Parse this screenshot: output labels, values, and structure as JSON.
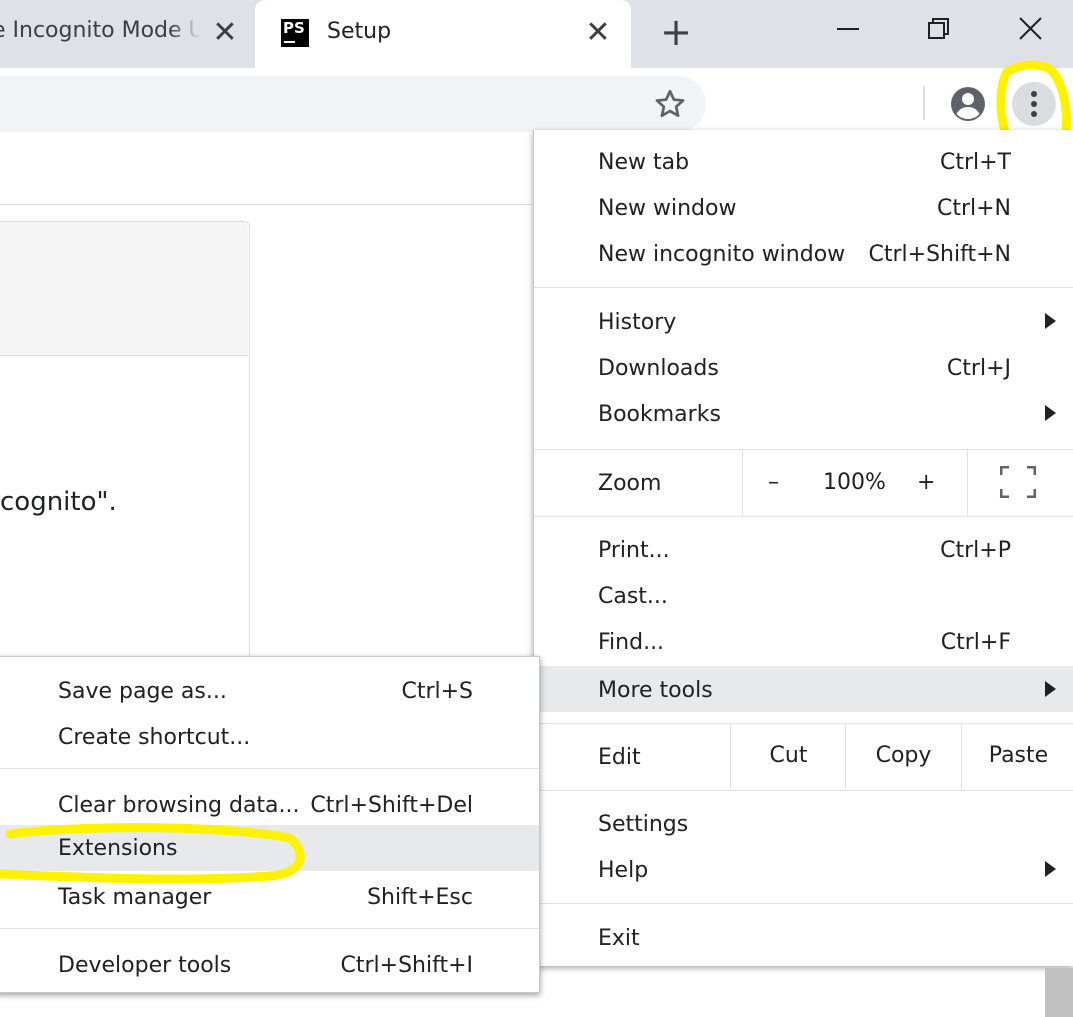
{
  "browser": {
    "tabs": [
      {
        "title": "e Incognito Mode U",
        "active": false
      },
      {
        "title": "Setup",
        "active": true,
        "favicon_text": "PS"
      }
    ],
    "close_glyph": "✕",
    "new_tab_glyph": "+",
    "window_controls": [
      "minimize-icon",
      "restore-icon",
      "close-icon"
    ]
  },
  "toolbar": {
    "icons": [
      "star-icon",
      "profile-icon",
      "more-vert-icon"
    ]
  },
  "page": {
    "visible_text": "cognito\"."
  },
  "menu": {
    "items_group1": [
      {
        "label": "New tab",
        "shortcut": "Ctrl+T"
      },
      {
        "label": "New window",
        "shortcut": "Ctrl+N"
      },
      {
        "label": "New incognito window",
        "shortcut": "Ctrl+Shift+N"
      }
    ],
    "items_group2": [
      {
        "label": "History",
        "shortcut": "",
        "submenu": true
      },
      {
        "label": "Downloads",
        "shortcut": "Ctrl+J"
      },
      {
        "label": "Bookmarks",
        "shortcut": "",
        "submenu": true
      }
    ],
    "zoom": {
      "label": "Zoom",
      "minus": "–",
      "value": "100%",
      "plus": "+"
    },
    "items_group3": [
      {
        "label": "Print...",
        "shortcut": "Ctrl+P"
      },
      {
        "label": "Cast...",
        "shortcut": ""
      },
      {
        "label": "Find...",
        "shortcut": "Ctrl+F"
      },
      {
        "label": "More tools",
        "shortcut": "",
        "submenu": true,
        "highlighted": true
      }
    ],
    "edit": {
      "label": "Edit",
      "cut": "Cut",
      "copy": "Copy",
      "paste": "Paste"
    },
    "items_group4": [
      {
        "label": "Settings",
        "shortcut": ""
      },
      {
        "label": "Help",
        "shortcut": "",
        "submenu": true
      }
    ],
    "exit_label": "Exit"
  },
  "submenu": {
    "group1": [
      {
        "label": "Save page as...",
        "shortcut": "Ctrl+S"
      },
      {
        "label": "Create shortcut...",
        "shortcut": ""
      }
    ],
    "group2": [
      {
        "label": "Clear browsing data...",
        "shortcut": "Ctrl+Shift+Del"
      },
      {
        "label": "Extensions",
        "shortcut": "",
        "highlighted": true
      },
      {
        "label": "Task manager",
        "shortcut": "Shift+Esc"
      }
    ],
    "group3": [
      {
        "label": "Developer tools",
        "shortcut": "Ctrl+Shift+I"
      }
    ]
  },
  "colors": {
    "highlighter": "#fff200",
    "hover_bg": "#e8e9ea",
    "tabstrip_bg": "#dee1e6"
  }
}
